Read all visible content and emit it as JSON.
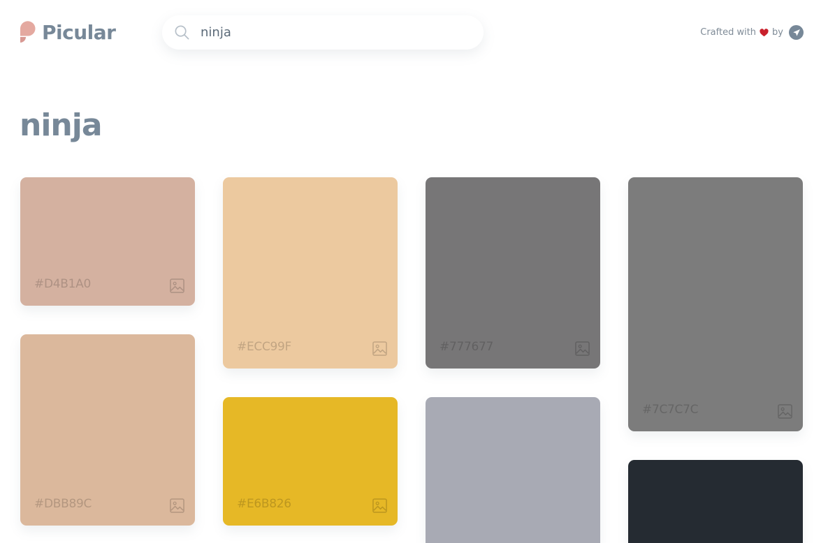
{
  "header": {
    "logo_text": "Picular",
    "search": {
      "value": "ninja",
      "placeholder": ""
    },
    "credit": {
      "prefix": "Crafted with",
      "by": "by"
    }
  },
  "title": "ninja",
  "colors": {
    "brand": "#778898",
    "logo_top": "#E4A9A0",
    "logo_bottom": "#D89993",
    "heart": "#C8202C"
  },
  "swatches": [
    {
      "hex": "#D4B1A0",
      "label": "#D4B1A0"
    },
    {
      "hex": "#DBB89C",
      "label": "#DBB89C"
    },
    {
      "hex": "#ECC99F",
      "label": "#ECC99F"
    },
    {
      "hex": "#E6B826",
      "label": "#E6B826"
    },
    {
      "hex": "#777677",
      "label": "#777677"
    },
    {
      "hex": "#A8AAB4",
      "label": ""
    },
    {
      "hex": "#7C7C7C",
      "label": "#7C7C7C"
    },
    {
      "hex": "#252B32",
      "label": ""
    }
  ],
  "icons": {
    "search": "search-icon",
    "heart": "heart-icon",
    "rocket": "rocket-icon",
    "image": "image-icon"
  }
}
